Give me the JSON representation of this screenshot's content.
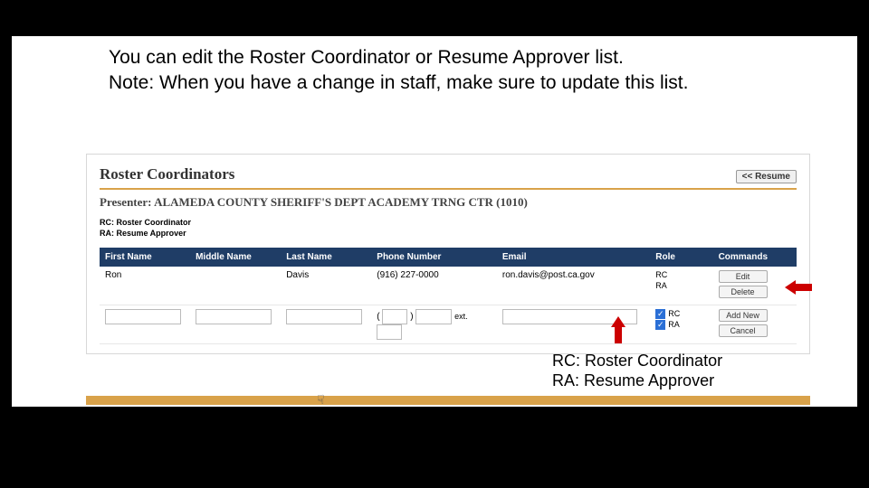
{
  "heading": {
    "line1": "You can edit the Roster Coordinator or Resume Approver list.",
    "line2": "Note: When you have a change in staff, make sure to update this list."
  },
  "panel": {
    "title": "Roster Coordinators",
    "resume_btn": "<< Resume",
    "presenter_label": "Presenter:",
    "presenter_name": "ALAMEDA COUNTY SHERIFF'S DEPT ACADEMY TRNG CTR (1010)",
    "legend": {
      "rc": "RC: Roster Coordinator",
      "ra": "RA: Resume Approver"
    },
    "columns": {
      "first": "First Name",
      "middle": "Middle Name",
      "last": "Last Name",
      "phone": "Phone Number",
      "email": "Email",
      "role": "Role",
      "commands": "Commands"
    },
    "rows": [
      {
        "first": "Ron",
        "middle": "",
        "last": "Davis",
        "phone": "(916) 227-0000",
        "email": "ron.davis@post.ca.gov",
        "role1": "RC",
        "role2": "RA",
        "cmd1": "Edit",
        "cmd2": "Delete"
      }
    ],
    "input_row": {
      "ext_label": "ext.",
      "role_rc": "RC",
      "role_ra": "RA",
      "cmd_add": "Add New",
      "cmd_cancel": "Cancel"
    }
  },
  "annotation": {
    "rc": "RC: Roster Coordinator",
    "ra": "RA: Resume Approver"
  },
  "colors": {
    "header_bg": "#1f3d66",
    "accent": "#d9a24a",
    "arrow": "#cc0000"
  }
}
